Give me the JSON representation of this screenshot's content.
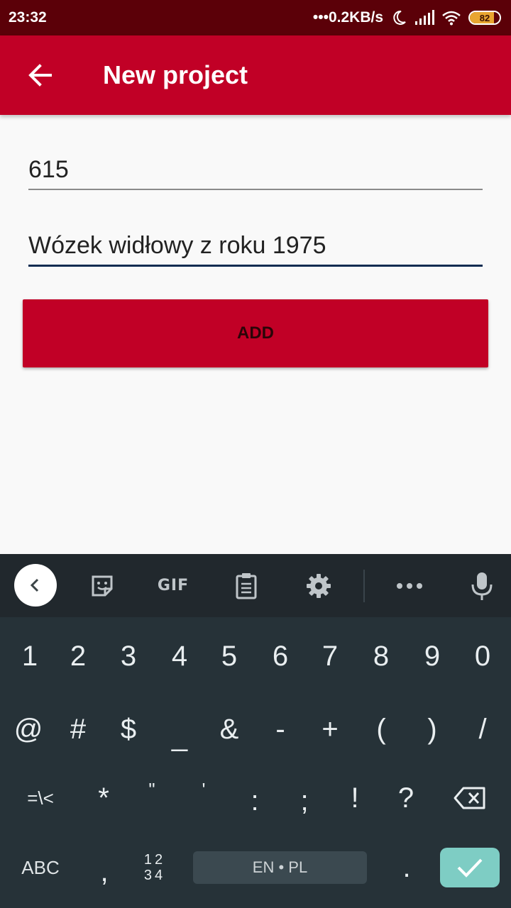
{
  "status_bar": {
    "time": "23:32",
    "network_speed": "•••0.2KB/s",
    "battery_level": "82",
    "battery_color": "#e8a530",
    "icons": [
      "moon-icon",
      "signal-icon",
      "wifi-icon",
      "battery-icon"
    ]
  },
  "app_bar": {
    "title": "New project",
    "background": "#c10026",
    "back_icon": "arrow-left-icon"
  },
  "form": {
    "field_1_value": "615",
    "field_2_value": "Wózek widłowy z roku 1975",
    "add_label": "ADD"
  },
  "keyboard": {
    "toolbar": {
      "gif_label": "GIF",
      "icons": [
        "chevron-left-icon",
        "sticker-icon",
        "clipboard-icon",
        "gear-icon",
        "more-icon",
        "microphone-icon"
      ]
    },
    "row_numbers": [
      "1",
      "2",
      "3",
      "4",
      "5",
      "6",
      "7",
      "8",
      "9",
      "0"
    ],
    "row_symbols_1": [
      "@",
      "#",
      "$",
      "_",
      "&",
      "-",
      "+",
      "(",
      ")",
      "/"
    ],
    "row_symbols_2": [
      "=\\<",
      "*",
      "\"",
      "'",
      ":",
      ";",
      "!",
      "?"
    ],
    "abc_label": "ABC",
    "comma_label": ",",
    "numpad_label_top": "12",
    "numpad_label_bottom": "34",
    "space_label": "EN • PL",
    "period_label": ".",
    "enter_icon": "check-icon"
  }
}
